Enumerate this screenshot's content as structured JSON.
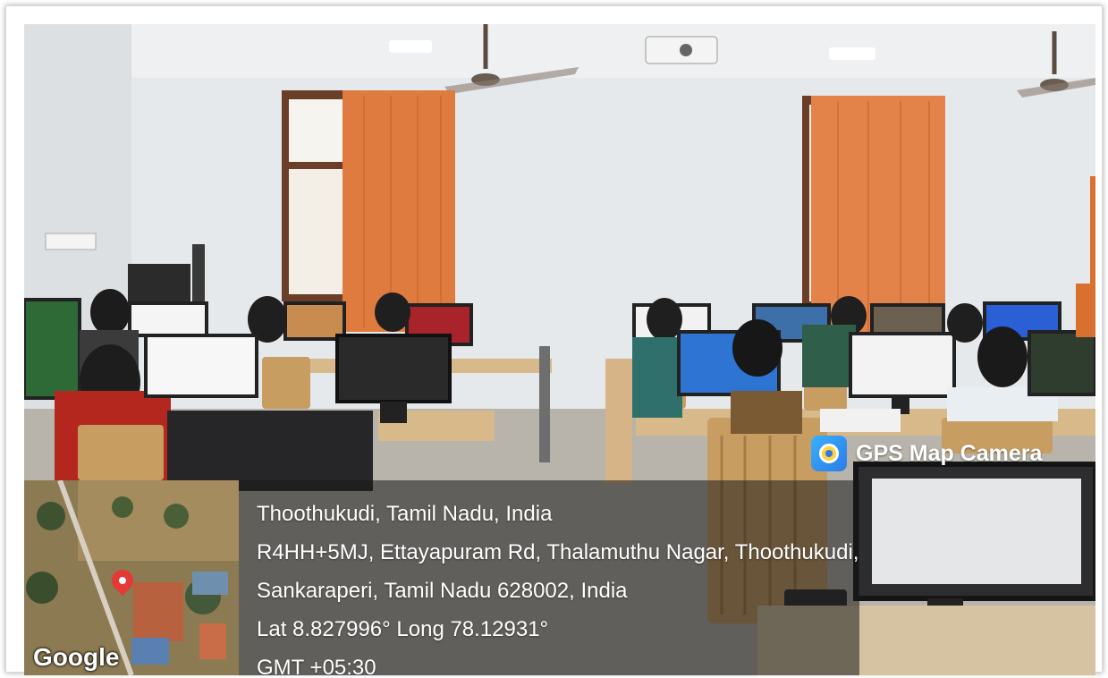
{
  "badge": {
    "label": "GPS Map Camera",
    "icon": "camera-app-icon"
  },
  "location": {
    "line1": "Thoothukudi, Tamil Nadu, India",
    "line2": "R4HH+5MJ, Ettayapuram Rd, Thalamuthu Nagar, Thoothukudi,",
    "line3": "Sankaraperi, Tamil Nadu 628002, India",
    "coords": "Lat 8.827996° Long 78.12931°",
    "timezone": "GMT +05:30"
  },
  "map": {
    "attribution": "Google",
    "pin_icon": "location-pin-icon"
  },
  "colors": {
    "wall": "#e9ecee",
    "curtain": "#e07b3f",
    "desk": "#d8b98a",
    "overlay": "#191919"
  }
}
